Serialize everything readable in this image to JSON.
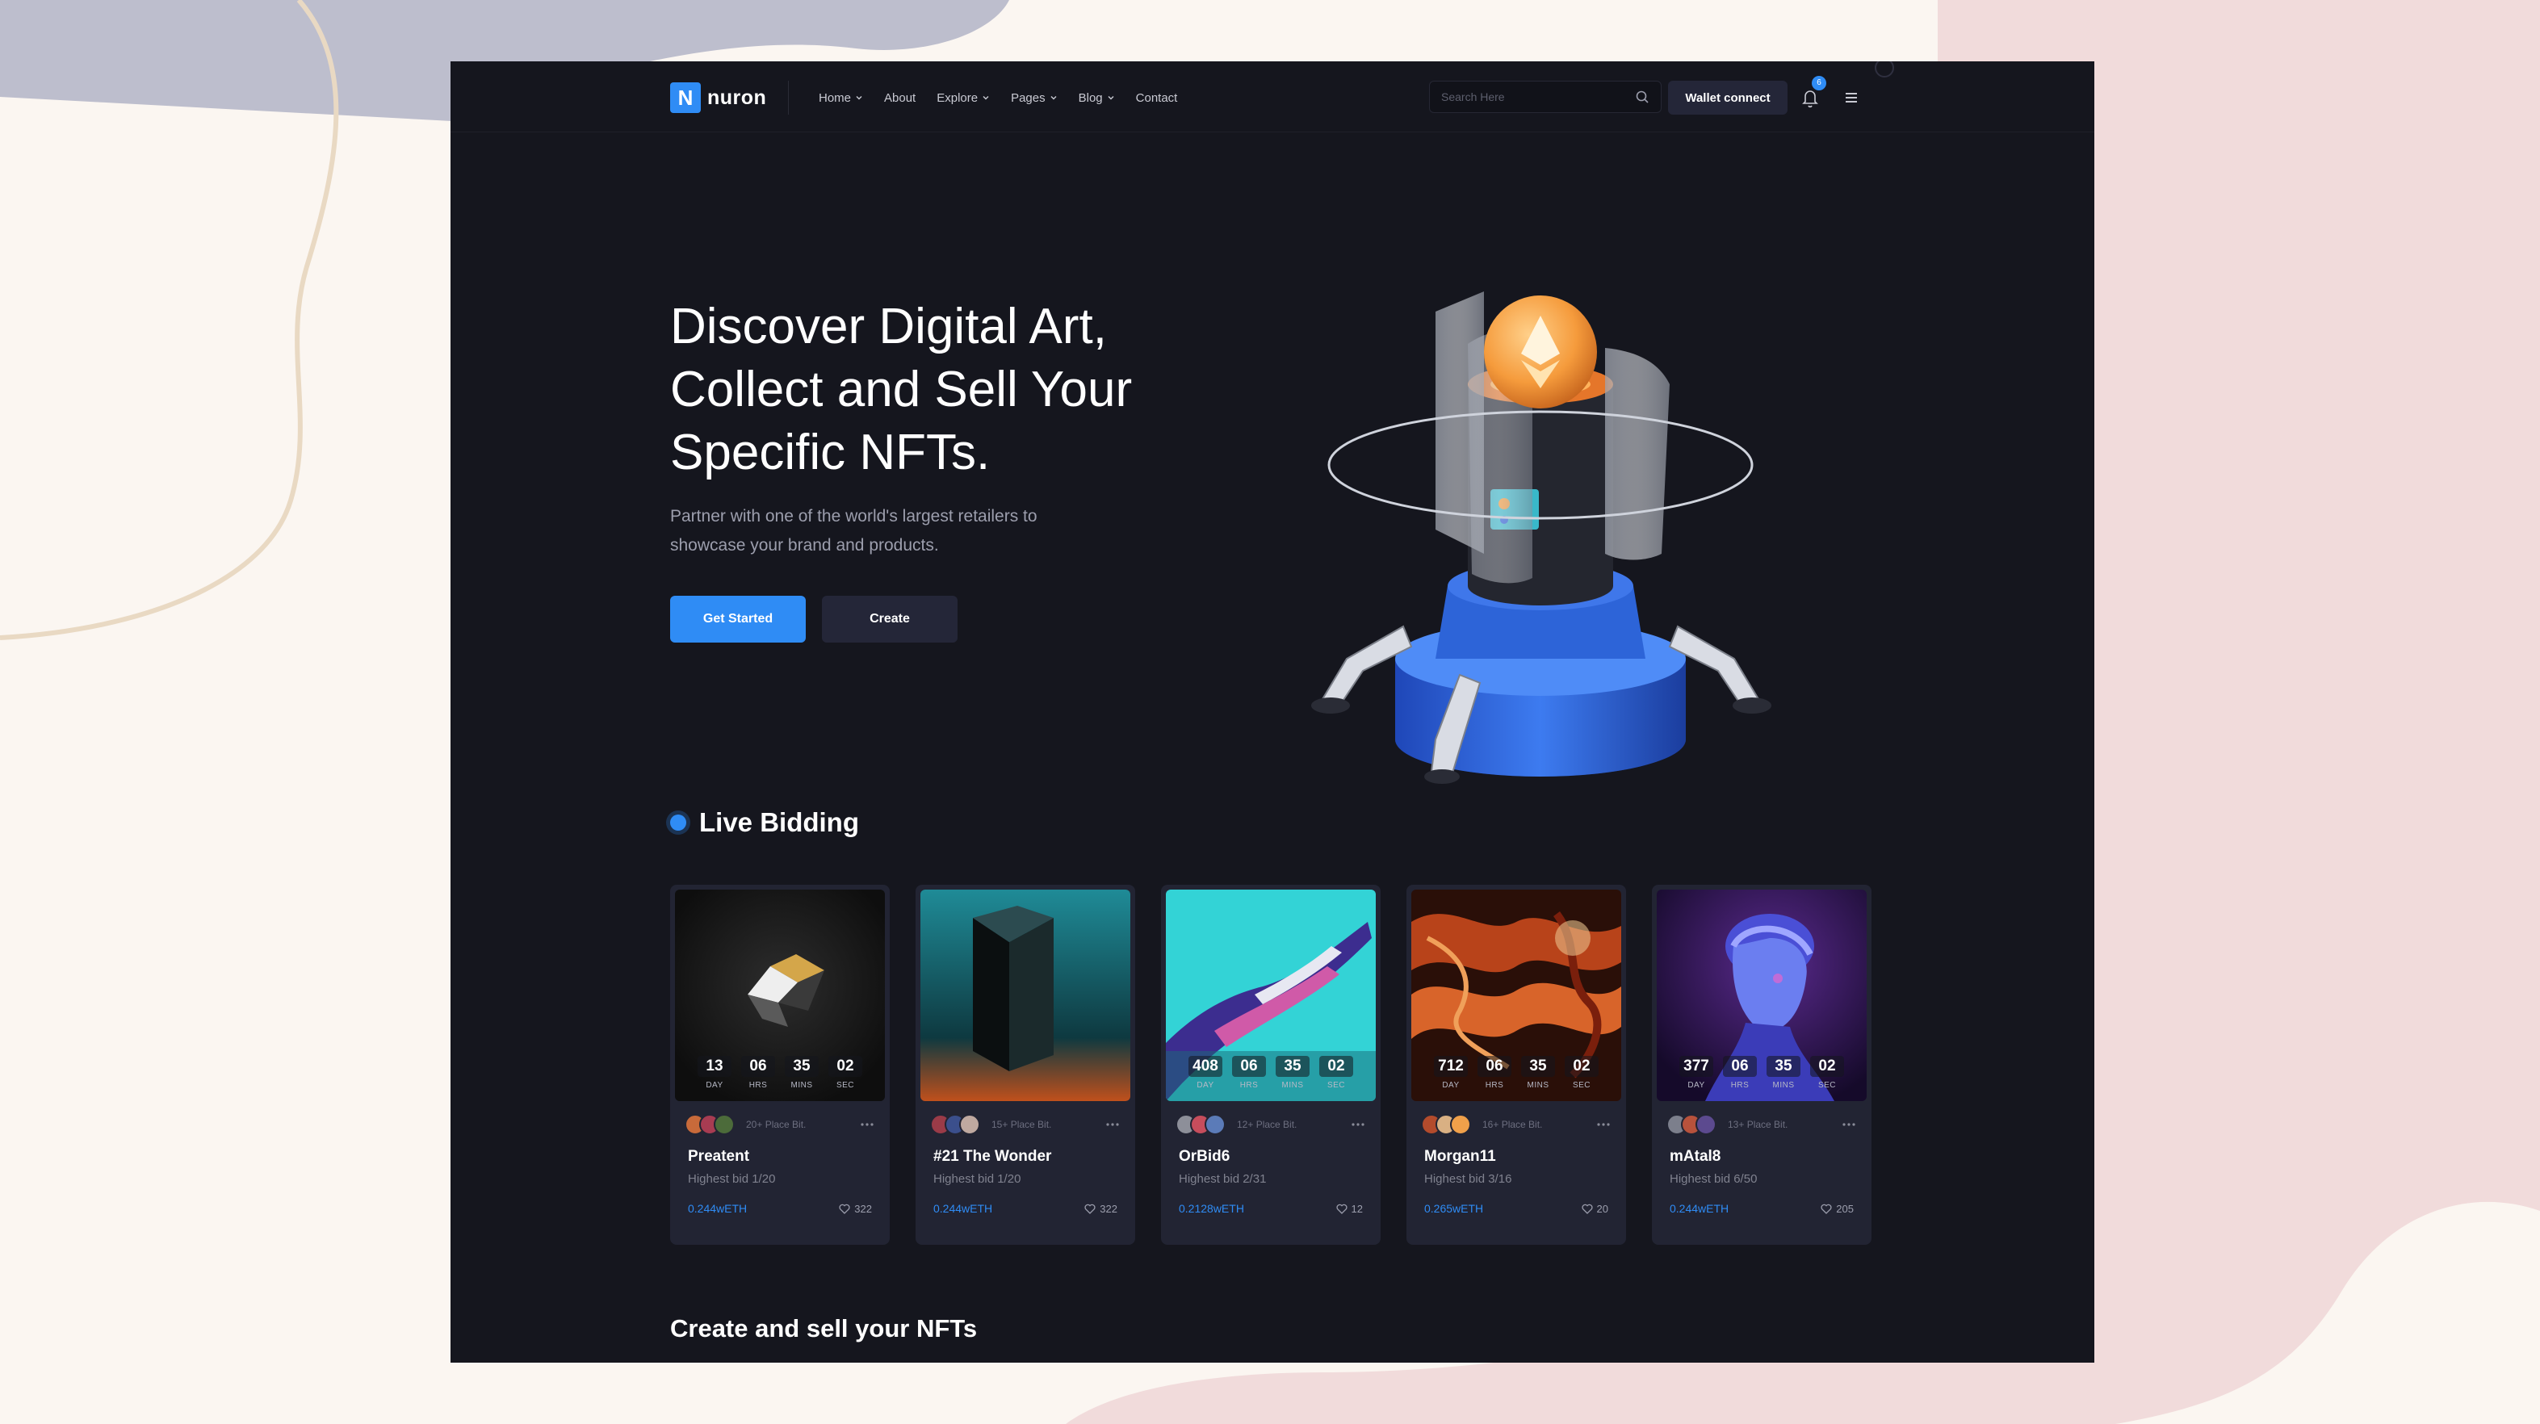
{
  "colors": {
    "accent": "#2f8cf5",
    "page_bg": "#15161e",
    "card_bg": "#222433",
    "outer_bg": "#fbf6f1",
    "blob_blue": "#bebfce",
    "blob_pink": "#f2dcdc"
  },
  "brand": {
    "logo_letter": "N",
    "name": "nuron"
  },
  "nav": {
    "items": [
      {
        "label": "Home",
        "dropdown": true
      },
      {
        "label": "About",
        "dropdown": false
      },
      {
        "label": "Explore",
        "dropdown": true
      },
      {
        "label": "Pages",
        "dropdown": true
      },
      {
        "label": "Blog",
        "dropdown": true
      },
      {
        "label": "Contact",
        "dropdown": false
      }
    ],
    "search_placeholder": "Search Here",
    "wallet_label": "Wallet connect",
    "notification_count": "6",
    "icons": [
      "search-icon",
      "bell-icon",
      "menu-icon"
    ]
  },
  "hero": {
    "title_lines": [
      "Discover Digital Art,",
      "Collect and Sell Your",
      "Specific NFTs."
    ],
    "subtitle_lines": [
      "Partner with one of the world's largest retailers to",
      "showcase your brand and products."
    ],
    "primary_button": "Get Started",
    "secondary_button": "Create"
  },
  "live_bidding": {
    "title": "Live Bidding",
    "countdown_labels": [
      "DAY",
      "HRS",
      "MINS",
      "SEC"
    ],
    "cards": [
      {
        "name": "Preatent",
        "bid": "Highest bid 1/20",
        "price": "0.244wETH",
        "likes": "322",
        "place_bit": "20+ Place Bit.",
        "countdown": [
          "13",
          "06",
          "35",
          "02"
        ],
        "theme": "dark-crystal"
      },
      {
        "name": "#21 The Wonder",
        "bid": "Highest bid 1/20",
        "price": "0.244wETH",
        "likes": "322",
        "place_bit": "15+ Place Bit.",
        "countdown": [
          "",
          "",
          "",
          ""
        ],
        "theme": "teal-prism"
      },
      {
        "name": "OrBid6",
        "bid": "Highest bid 2/31",
        "price": "0.2128wETH",
        "likes": "12",
        "place_bit": "12+ Place Bit.",
        "countdown": [
          "408",
          "06",
          "35",
          "02"
        ],
        "theme": "cyan-hand"
      },
      {
        "name": "Morgan11",
        "bid": "Highest bid 3/16",
        "price": "0.265wETH",
        "likes": "20",
        "place_bit": "16+ Place Bit.",
        "countdown": [
          "712",
          "06",
          "35",
          "02"
        ],
        "theme": "orange-swirl"
      },
      {
        "name": "mAtal8",
        "bid": "Highest bid 6/50",
        "price": "0.244wETH",
        "likes": "205",
        "place_bit": "13+ Place Bit.",
        "countdown": [
          "377",
          "06",
          "35",
          "02"
        ],
        "theme": "purple-bust"
      }
    ]
  },
  "create_section": {
    "title": "Create and sell your NFTs"
  }
}
